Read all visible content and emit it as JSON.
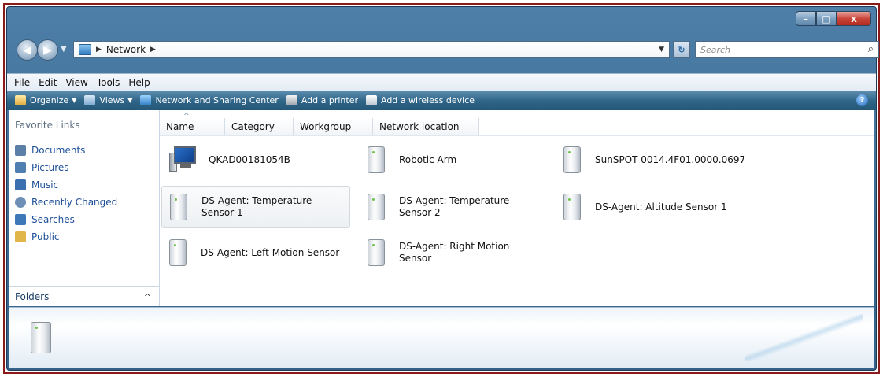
{
  "window": {
    "caption_buttons": {
      "minimize": "–",
      "maximize": "□",
      "close": "x"
    }
  },
  "nav": {
    "address_path": [
      "Network"
    ],
    "search_placeholder": "Search",
    "back_icon": "back-arrow-icon",
    "forward_icon": "forward-arrow-icon"
  },
  "menubar": {
    "items": [
      "File",
      "Edit",
      "View",
      "Tools",
      "Help"
    ]
  },
  "toolbar": {
    "organize": "Organize",
    "views": "Views",
    "network_sharing": "Network and Sharing Center",
    "add_printer": "Add a printer",
    "add_wireless": "Add a wireless device",
    "help_icon": "?"
  },
  "sidebar": {
    "heading": "Favorite Links",
    "items": [
      {
        "label": "Documents",
        "color": "#5b7fa6"
      },
      {
        "label": "Pictures",
        "color": "#4f7fb0"
      },
      {
        "label": "Music",
        "color": "#3a6fb0"
      },
      {
        "label": "Recently Changed",
        "color": "#6d8fb5"
      },
      {
        "label": "Searches",
        "color": "#3e78b8"
      },
      {
        "label": "Public",
        "color": "#e0b54a"
      }
    ],
    "folders_label": "Folders",
    "folders_chevron": "^"
  },
  "columns": [
    "Name",
    "Category",
    "Workgroup",
    "Network location"
  ],
  "items": [
    {
      "label": "QKAD00181054B",
      "kind": "computer"
    },
    {
      "label": "Robotic Arm",
      "kind": "device"
    },
    {
      "label": "SunSPOT 0014.4F01.0000.0697",
      "kind": "device"
    },
    {
      "label_line1": "DS-Agent: Temperature",
      "label_line2": "Sensor 1",
      "kind": "device",
      "selected": true
    },
    {
      "label_line1": "DS-Agent: Temperature",
      "label_line2": "Sensor 2",
      "kind": "device"
    },
    {
      "label": "DS-Agent: Altitude Sensor 1",
      "kind": "device"
    },
    {
      "label": "DS-Agent: Left Motion Sensor",
      "kind": "device"
    },
    {
      "label_line1": "DS-Agent: Right Motion",
      "label_line2": "Sensor",
      "kind": "device"
    }
  ]
}
